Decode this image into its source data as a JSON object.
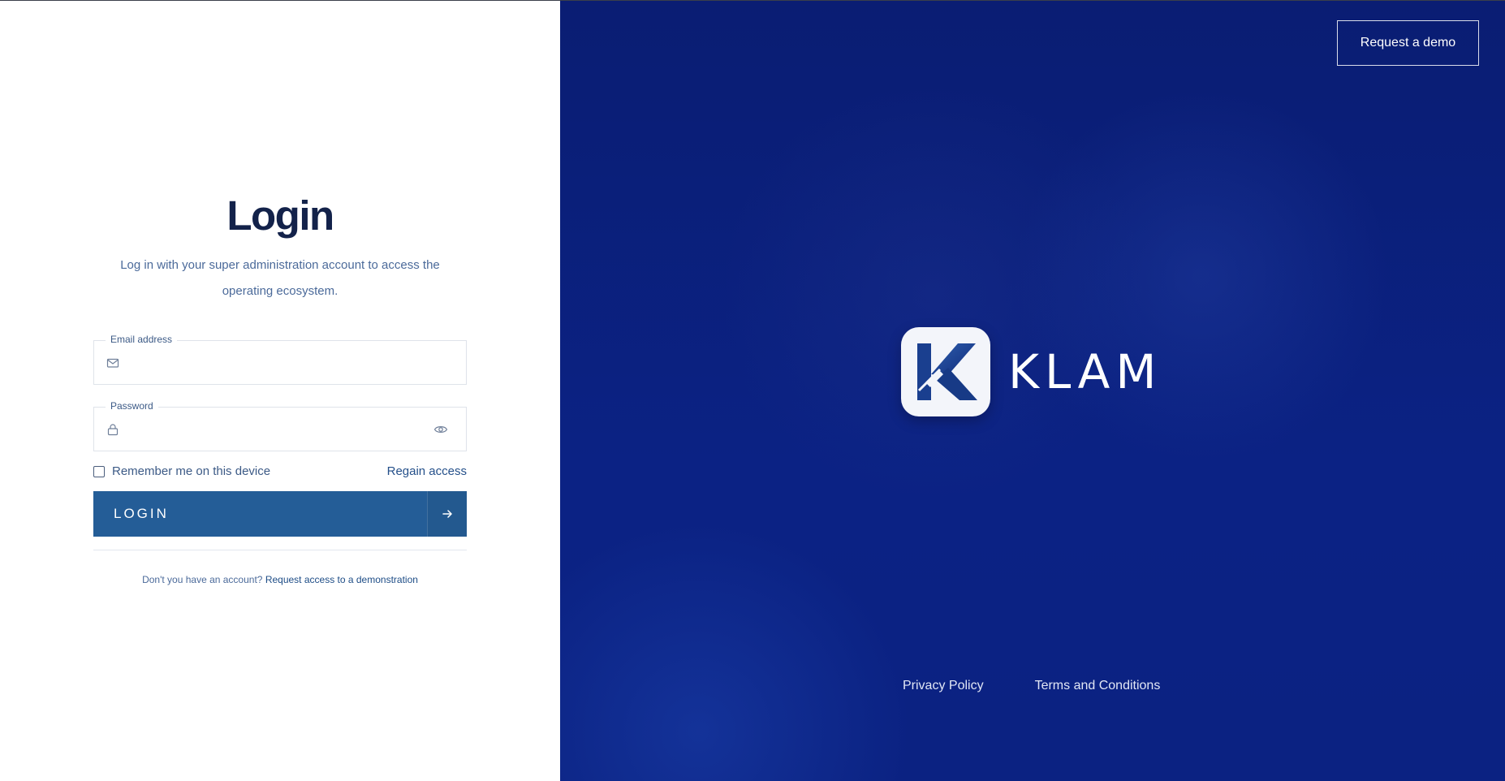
{
  "login": {
    "title": "Login",
    "subtitle": "Log in with your super administration account to access the operating ecosystem.",
    "email": {
      "label": "Email address",
      "value": "",
      "placeholder": ""
    },
    "password": {
      "label": "Password",
      "value": "",
      "placeholder": ""
    },
    "remember_label": "Remember me on this device",
    "remember_checked": false,
    "regain_label": "Regain access",
    "login_button_label": "LOGIN",
    "signup_prompt": "Don't you have an account?",
    "signup_link": "Request access to a demonstration"
  },
  "brand": {
    "name": "KLAM",
    "demo_button_label": "Request a demo",
    "privacy_link": "Privacy Policy",
    "terms_link": "Terms and Conditions",
    "colors": {
      "primary": "#245d97",
      "panel_bg": "#0a1f78",
      "title": "#13224a"
    }
  },
  "icons": {
    "email": "mail-icon",
    "password": "lock-icon",
    "toggle_visibility": "eye-icon",
    "submit": "arrow-right-icon"
  }
}
